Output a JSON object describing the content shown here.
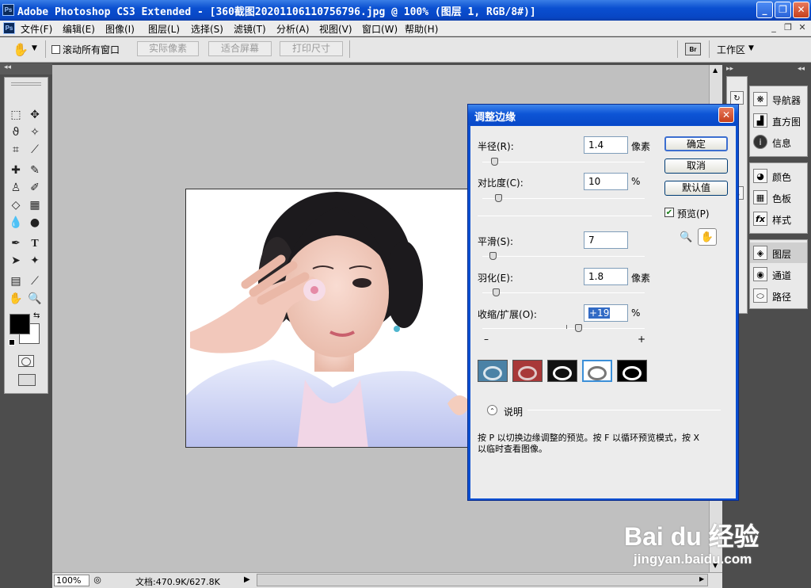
{
  "window": {
    "app_icon": "Ps",
    "title": "Adobe Photoshop CS3 Extended - [360截图20201106110756796.jpg @ 100% (图层 1, RGB/8#)]",
    "controls": [
      "_",
      "❐",
      "✕"
    ],
    "doc_controls": [
      "_",
      "❐",
      "✕"
    ]
  },
  "menubar": {
    "doc_icon": "Ps",
    "items": [
      "文件(F)",
      "编辑(E)",
      "图像(I)",
      "图层(L)",
      "选择(S)",
      "滤镜(T)",
      "分析(A)",
      "视图(V)",
      "窗口(W)",
      "帮助(H)"
    ]
  },
  "options": {
    "tool_icon": "hand-icon",
    "scroll_all_label": "滚动所有窗口",
    "buttons": [
      "实际像素",
      "适合屏幕",
      "打印尺寸"
    ],
    "workspace_label": "工作区"
  },
  "status": {
    "zoom": "100%",
    "doc_info": "文档:470.9K/627.8K"
  },
  "panels": {
    "group1": [
      "导航器",
      "直方图",
      "信息"
    ],
    "group2": [
      "颜色",
      "色板",
      "样式"
    ],
    "group3": [
      "图层",
      "通道",
      "路径"
    ]
  },
  "dialog": {
    "title": "调整边缘",
    "radius": {
      "label": "半径(R):",
      "value": "1.4",
      "unit": "像素",
      "level": 0.08
    },
    "contrast": {
      "label": "对比度(C):",
      "value": "10",
      "unit": "%",
      "level": 0.1
    },
    "smooth": {
      "label": "平滑(S):",
      "value": "7",
      "unit": "",
      "level": 0.07
    },
    "feather": {
      "label": "羽化(E):",
      "value": "1.8",
      "unit": "像素",
      "level": 0.09
    },
    "contract": {
      "label": "收缩/扩展(O):",
      "value": "+19",
      "unit": "%",
      "level": 0.595,
      "minus": "–",
      "plus": "+"
    },
    "buttons": {
      "ok": "确定",
      "cancel": "取消",
      "default": "默认值"
    },
    "preview_label": "预览(P)",
    "description_label": "说明",
    "help_text_1": "按 P 以切换边缘调整的预览。按 F 以循环预览模式，按 X",
    "help_text_2": "以临时查看图像。"
  },
  "watermark": {
    "brand": "Bai du 经验",
    "url": "jingyan.baidu.com"
  }
}
